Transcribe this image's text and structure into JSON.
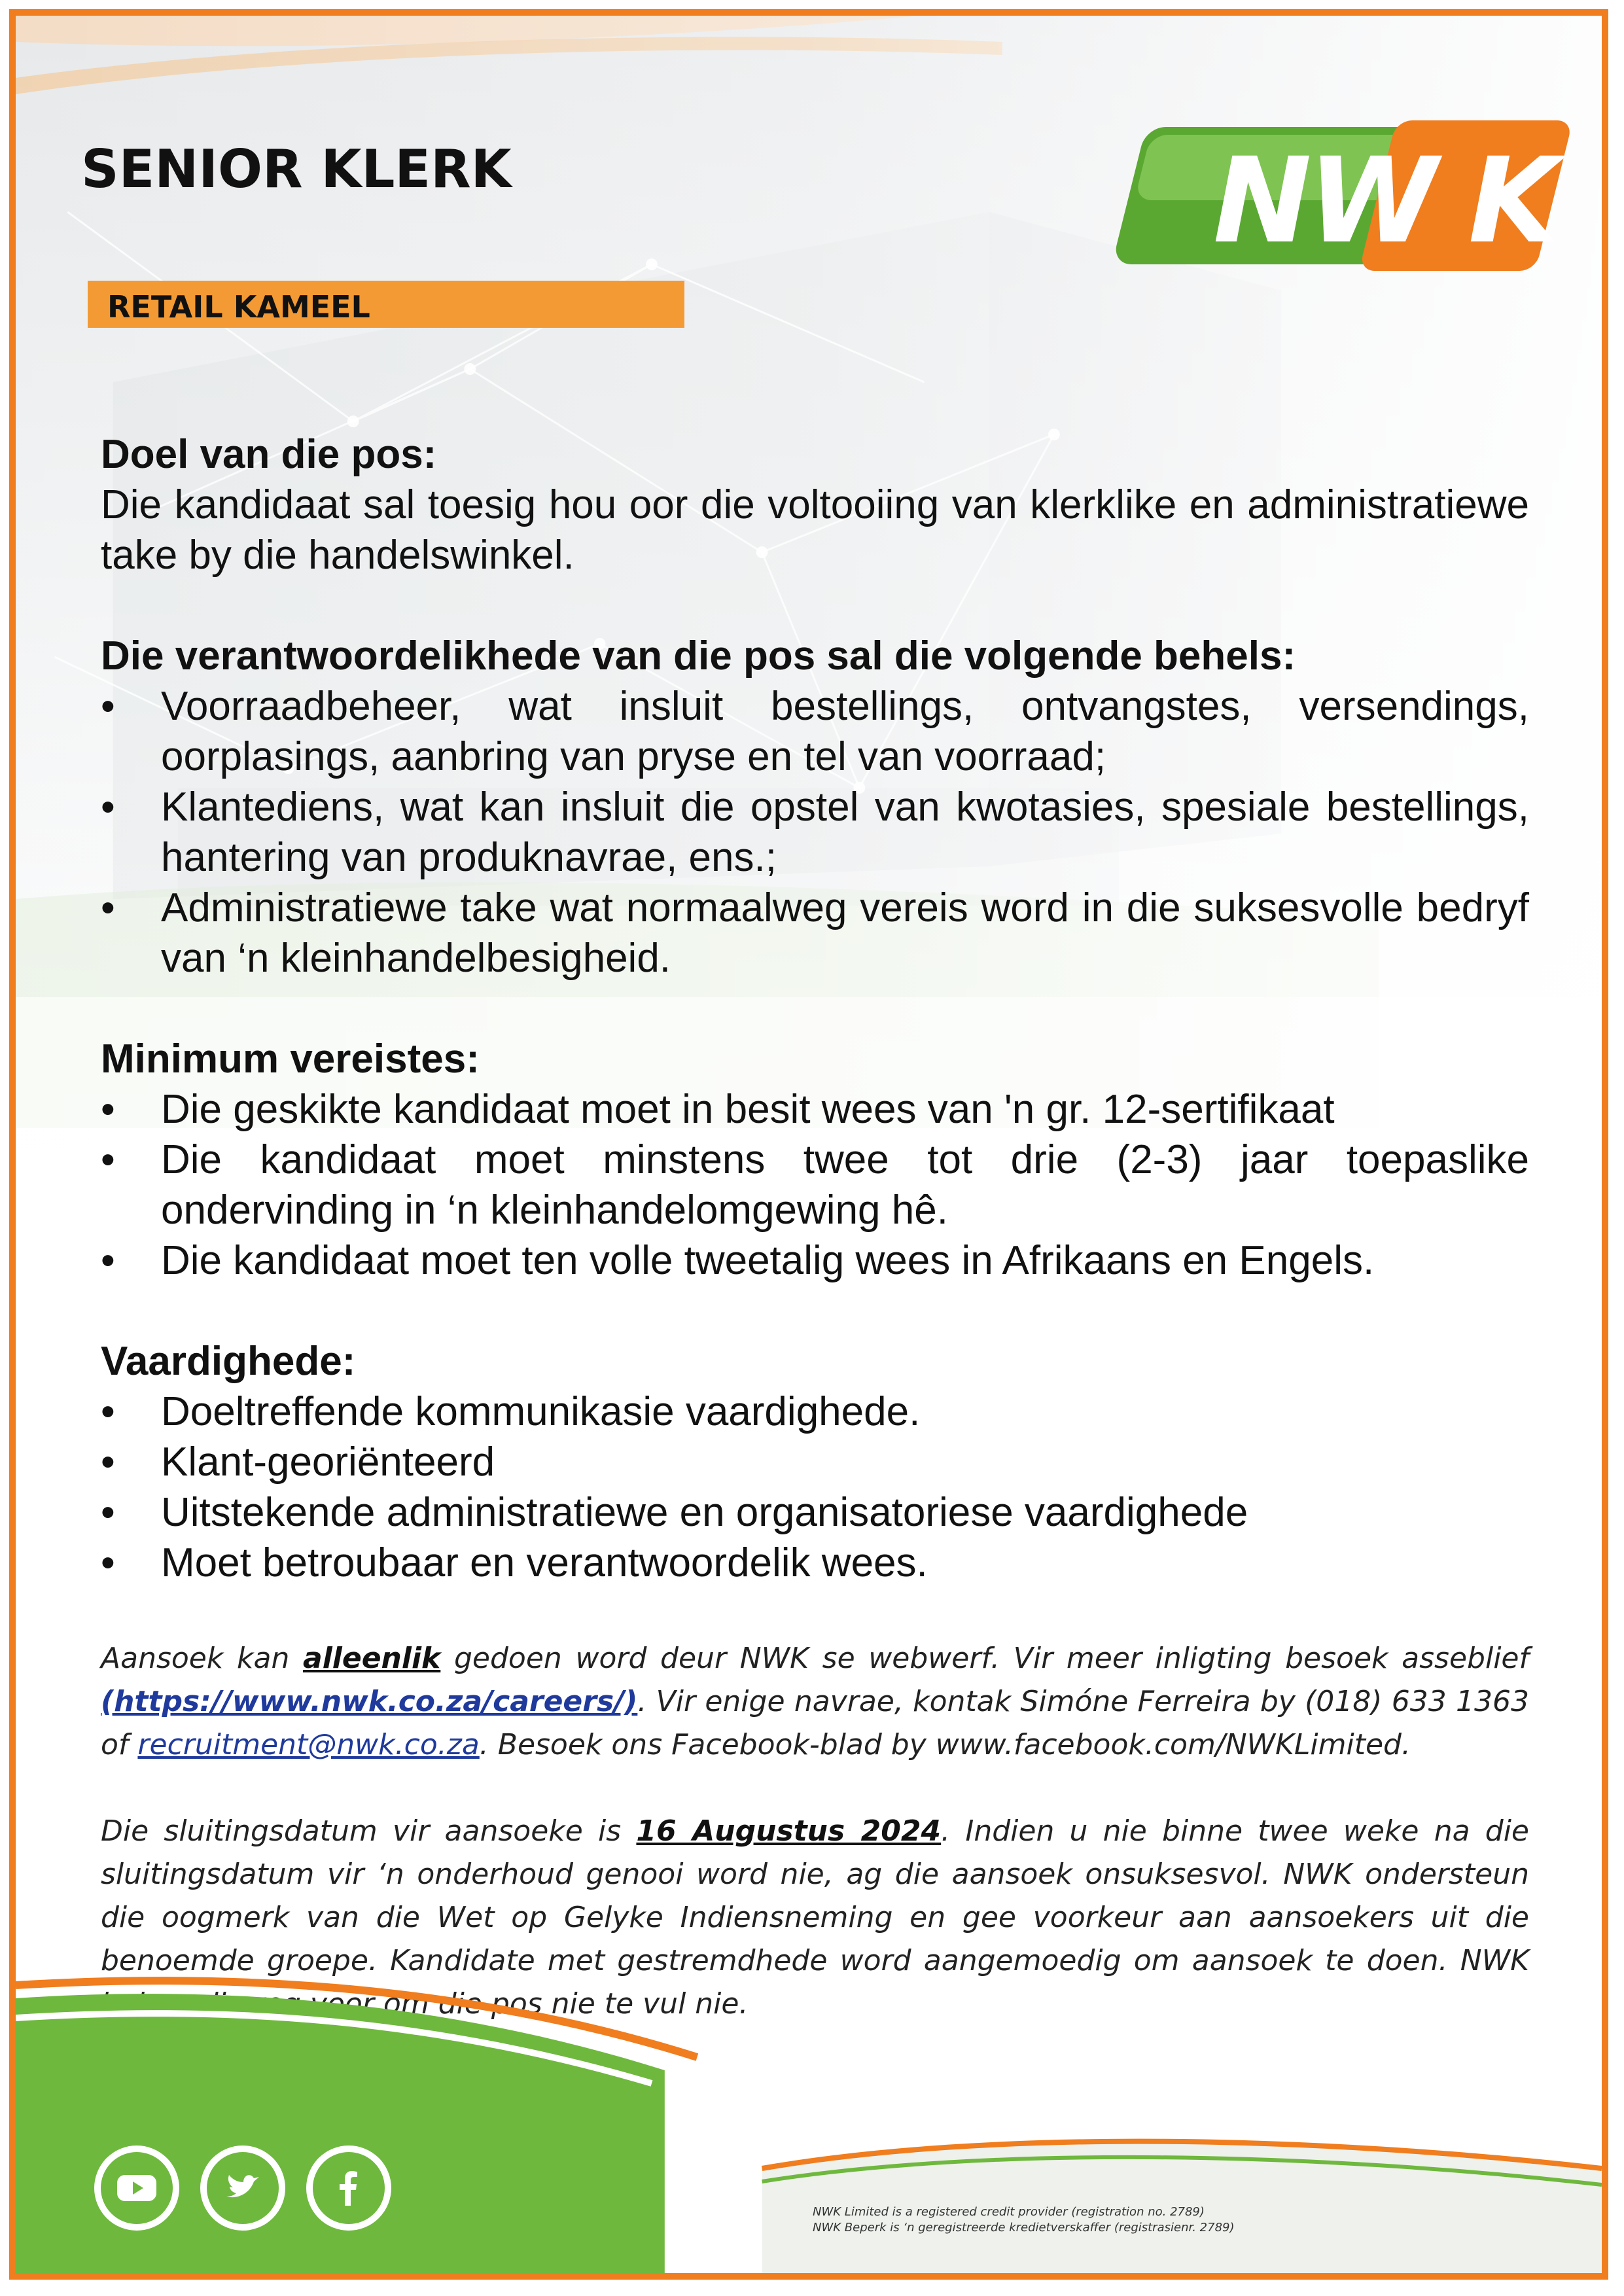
{
  "header": {
    "title": "SENIOR KLERK",
    "subtitle": "RETAIL KAMEEL",
    "logo_text": "NWK"
  },
  "sections": {
    "purpose": {
      "heading": "Doel van die pos:",
      "text": "Die kandidaat sal toesig hou oor die voltooiing van klerklike en administratiewe take by die handelswinkel."
    },
    "responsibilities": {
      "heading": "Die verantwoordelikhede van die pos sal die volgende behels:",
      "items": [
        "Voorraadbeheer, wat insluit bestellings, ontvangstes, versendings, oorplasings, aanbring van pryse en tel van voorraad;",
        "Klantediens, wat kan insluit die opstel van kwotasies, spesiale bestellings, hantering van produknavrae, ens.;",
        "Administratiewe take wat normaalweg vereis word in die suksesvolle bedryf van ‘n kleinhandelbesigheid."
      ]
    },
    "requirements": {
      "heading": "Minimum vereistes:",
      "items": [
        "Die geskikte kandidaat moet in besit wees van 'n gr. 12-sertifikaat",
        "Die kandidaat moet minstens twee tot drie (2-3) jaar toepaslike ondervinding in ‘n kleinhandelomgewing hê.",
        "Die kandidaat moet ten volle tweetalig wees in Afrikaans en Engels."
      ]
    },
    "skills": {
      "heading": "Vaardighede:",
      "items": [
        "Doeltreffende kommunikasie vaardighede.",
        "Klant-georiënteerd",
        "Uitstekende administratiewe en organisatoriese vaardighede",
        "Moet betroubaar en verantwoordelik wees."
      ]
    },
    "bullet": "•"
  },
  "application": {
    "p1_a": "Aansoek kan ",
    "p1_em": "alleenlik",
    "p1_b": " gedoen word deur NWK se webwerf. Vir meer inligting besoek asseblief ",
    "careers_link": "(https://www.nwk.co.za/careers/)",
    "p1_c": ". Vir enige navrae, kontak Simóne Ferreira by (018) 633 1363 of ",
    "email_link": "recruitment@nwk.co.za",
    "p1_d": ".   Besoek ons Facebook-blad by www.facebook.com/NWKLimited.",
    "p2_a": "Die sluitingsdatum vir aansoeke is ",
    "closing_date": "16 Augustus 2024",
    "p2_b": ". Indien u nie binne twee weke na die sluitingsdatum vir ‘n onderhoud genooi word nie, ag die aansoek onsuksesvol. NWK ondersteun die oogmerk van die Wet op Gelyke Indiensneming en gee voorkeur aan aansoekers uit die benoemde groepe. Kandidate met gestremdhede word aangemoedig om aansoek te doen. NWK behou die reg voor om die pos nie te vul nie."
  },
  "footer": {
    "legal_en": "NWK Limited is a registered credit provider (registration no. 2789)",
    "legal_af": "NWK Beperk is ‘n geregistreerde kredietverskaffer (registrasienr. 2789)",
    "social_icons": [
      "youtube-icon",
      "twitter-icon",
      "facebook-icon"
    ]
  },
  "colors": {
    "orange": "#f07d1e",
    "subtitle_orange": "#f39a34",
    "green": "#6fb83e",
    "link_blue": "#1f3a9c"
  }
}
